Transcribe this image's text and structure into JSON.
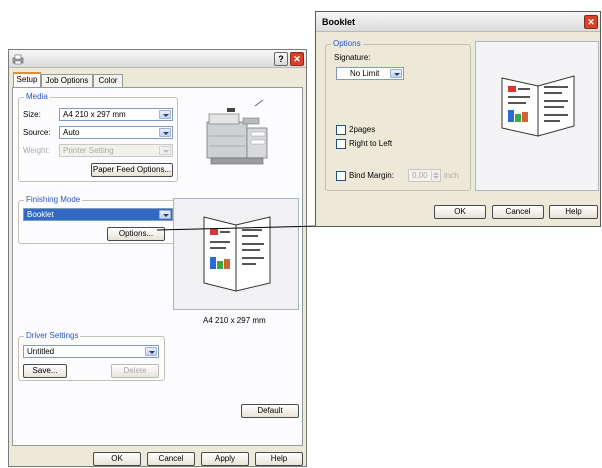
{
  "main_dialog": {
    "help_glyph": "?",
    "close_glyph": "✕",
    "tabs": [
      {
        "label": "Setup",
        "active": true
      },
      {
        "label": "Job Options",
        "active": false
      },
      {
        "label": "Color",
        "active": false
      }
    ],
    "media": {
      "title": "Media",
      "size_label": "Size:",
      "size_value": "A4 210 x 297 mm",
      "source_label": "Source:",
      "source_value": "Auto",
      "weight_label": "Weight:",
      "weight_value": "Printer Setting",
      "paper_feed_button": "Paper Feed Options..."
    },
    "finishing": {
      "title": "Finishing Mode",
      "mode_value": "Booklet",
      "options_button": "Options..."
    },
    "preview_caption": "A4 210 x 297 mm",
    "driver_settings": {
      "title": "Driver Settings",
      "value": "Untitled",
      "save_button": "Save...",
      "delete_button": "Delete"
    },
    "default_button": "Default",
    "buttons": {
      "ok": "OK",
      "cancel": "Cancel",
      "apply": "Apply",
      "help": "Help"
    }
  },
  "booklet_dialog": {
    "title": "Booklet",
    "close_glyph": "✕",
    "options_title": "Options",
    "signature_label": "Signature:",
    "signature_value": "No Limit",
    "checkboxes": [
      {
        "label": "2pages",
        "checked": false
      },
      {
        "label": "Right to Left",
        "checked": false
      },
      {
        "label": "Bind Margin:",
        "checked": false
      }
    ],
    "bind_margin_value": "0.00",
    "bind_margin_unit": "inch",
    "buttons": {
      "ok": "OK",
      "cancel": "Cancel",
      "help": "Help"
    }
  },
  "colors": {
    "accent_blue": "#2a55c8",
    "close_red": "#d8402a",
    "selection": "#316ac5",
    "tab_highlight": "#e68b2c"
  },
  "icons": [
    "printer-app-icon",
    "help-icon",
    "close-icon",
    "printer-image",
    "booklet-preview-icon",
    "spin-arrows-icon",
    "dropdown-arrow-icon"
  ]
}
